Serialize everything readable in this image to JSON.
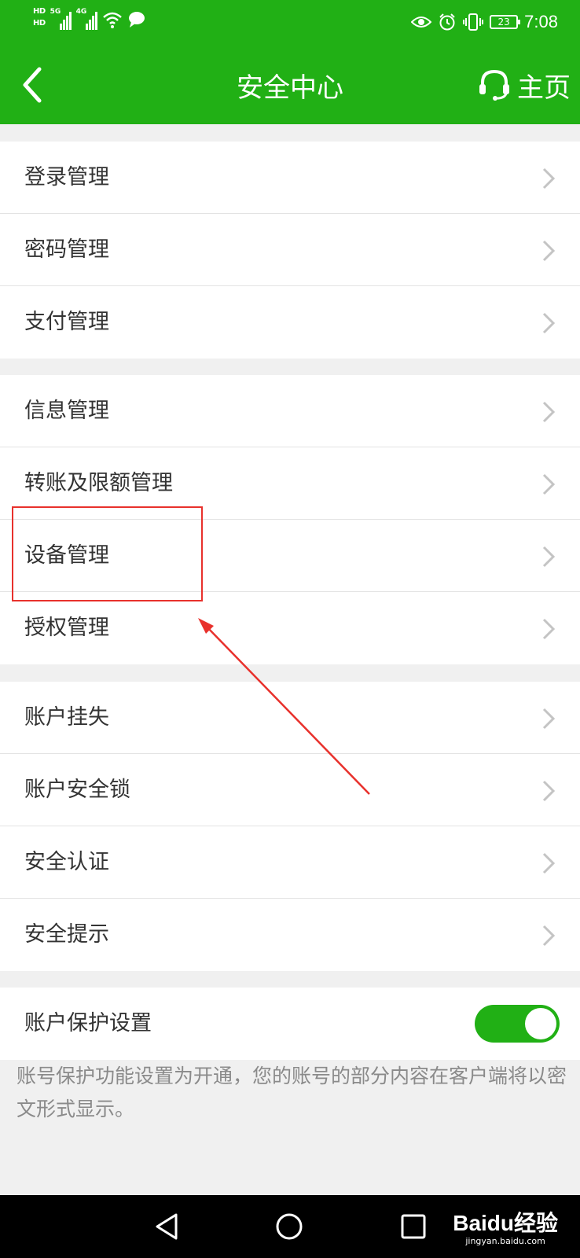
{
  "status_bar": {
    "hd1": "HD",
    "hd2": "HD",
    "net1": "5G",
    "net2": "4G",
    "battery": "23",
    "time": "7:08"
  },
  "nav": {
    "title": "安全中心",
    "home_label": "主页"
  },
  "groups": [
    {
      "items": [
        {
          "label": "登录管理"
        },
        {
          "label": "密码管理"
        },
        {
          "label": "支付管理"
        }
      ]
    },
    {
      "items": [
        {
          "label": "信息管理"
        },
        {
          "label": "转账及限额管理"
        },
        {
          "label": "设备管理"
        },
        {
          "label": "授权管理"
        }
      ]
    },
    {
      "items": [
        {
          "label": "账户挂失"
        },
        {
          "label": "账户安全锁"
        },
        {
          "label": "安全认证"
        },
        {
          "label": "安全提示"
        }
      ]
    }
  ],
  "protection": {
    "label": "账户保护设置",
    "enabled": true,
    "note": "账号保护功能设置为开通，您的账号的部分内容在客户端将以密文形式显示。"
  },
  "watermark": {
    "logo": "Baidu经验",
    "sub": "jingyan.baidu.com"
  },
  "colors": {
    "accent": "#21b015",
    "annotation": "#e8312c"
  }
}
